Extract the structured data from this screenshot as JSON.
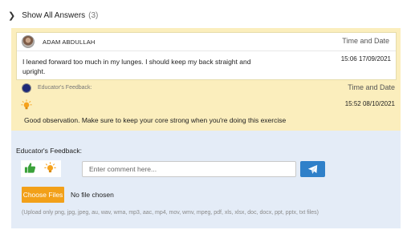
{
  "thread": {
    "show_all_label": "Show All Answers",
    "count": "(3)"
  },
  "answer": {
    "author": "ADAM ABDULLAH",
    "time_header": "Time and Date",
    "text": "I leaned forward too much in my lunges. I should keep my back straight and upright.",
    "datetime": "15:06 17/09/2021"
  },
  "educator_reply": {
    "label": "Educator's Feedback:",
    "time_header": "Time and Date",
    "datetime": "15:52 08/10/2021",
    "text": "Good observation. Make sure to keep your core strong when you're doing this exercise"
  },
  "feedback_form": {
    "title": "Educator's Feedback:",
    "comment_placeholder": "Enter comment here...",
    "choose_files_label": "Choose Files",
    "no_file_label": "No file chosen",
    "upload_note": "(Upload only png, jpg, jpeg, au, wav, wma, mp3, aac, mp4, mov, wmv, mpeg, pdf, xls, xlsx, doc, docx, ppt, pptx, txt files)"
  },
  "icons": {
    "expand": "chevron-right-icon",
    "thumbs_up": "thumbs-up-icon",
    "lightbulb": "lightbulb-icon",
    "send": "send-icon"
  },
  "colors": {
    "reply_panel": "#fbeebd",
    "form_panel": "#e4ecf7",
    "send_button": "#2f80c9",
    "choose_button": "#f2a019",
    "thumbs_up": "#3aa13a",
    "lightbulb": "#f6a21c"
  }
}
